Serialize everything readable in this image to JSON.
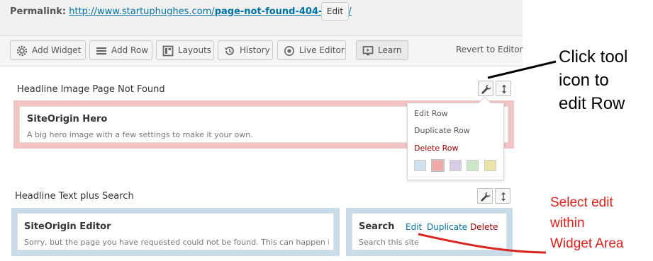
{
  "permalink": {
    "label": "Permalink:",
    "url_base": "http://www.startuphughes.com/",
    "url_slug": "page-not-found-404-error",
    "url_tail": "/",
    "edit_label": "Edit"
  },
  "toolbar": {
    "buttons": [
      {
        "label": "Add Widget",
        "icon": "gear-icon"
      },
      {
        "label": "Add Row",
        "icon": "menu-lines-icon"
      },
      {
        "label": "Layouts",
        "icon": "layout-icon"
      },
      {
        "label": "History",
        "icon": "history-icon"
      },
      {
        "label": "Live Editor",
        "icon": "eye-icon"
      },
      {
        "label": "Learn",
        "icon": "video-icon"
      }
    ],
    "revert_label": "Revert to Editor"
  },
  "rows": [
    {
      "title": "Headline Image Page Not Found",
      "widget": {
        "title": "SiteOrigin Hero",
        "description": "A big hero image with a few settings to make it your own."
      }
    },
    {
      "title": "Headline Text plus Search",
      "widget": {
        "title": "SiteOrigin Editor",
        "description": "Sorry, but the page you have requested could not be found. This can happen if"
      },
      "widget2": {
        "title": "Search",
        "description": "Search this site",
        "actions": {
          "edit": "Edit",
          "duplicate": "Duplicate",
          "delete": "Delete"
        }
      }
    }
  ],
  "row_menu": {
    "edit": "Edit Row",
    "duplicate": "Duplicate Row",
    "delete": "Delete Row",
    "swatches": [
      "#cfe2ee",
      "#f0a8a8",
      "#d8cce4",
      "#cde8c9",
      "#ece3a8"
    ]
  },
  "annotations": {
    "tool": [
      "Click tool",
      "icon to",
      "edit Row"
    ],
    "edit": [
      "Select edit",
      "within",
      "Widget Area"
    ]
  },
  "colors": {
    "accent": "#0073aa",
    "delete": "#aa0000",
    "annotation_red": "#e0201b",
    "row_pink": "#f2c4c4",
    "row_blue": "#c9dcea"
  }
}
